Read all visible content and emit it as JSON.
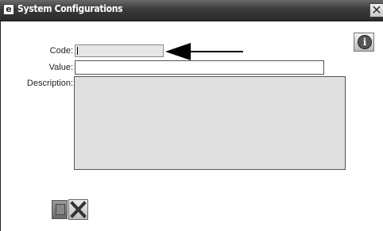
{
  "window": {
    "app_icon": "e-app-icon",
    "app_icon_glyph": "e",
    "title": "System Configurations",
    "close_glyph": "✕"
  },
  "toolbar": {
    "info_icon": "info-icon",
    "info_glyph": "i"
  },
  "form": {
    "code_label": "Code:",
    "code_value": "",
    "value_label": "Value:",
    "value_value": "",
    "description_label": "Description:",
    "description_value": ""
  },
  "annotation": {
    "arrow_icon": "left-arrow-icon"
  },
  "actions": {
    "save_icon": "save-icon",
    "cancel_icon": "cancel-x-icon"
  }
}
